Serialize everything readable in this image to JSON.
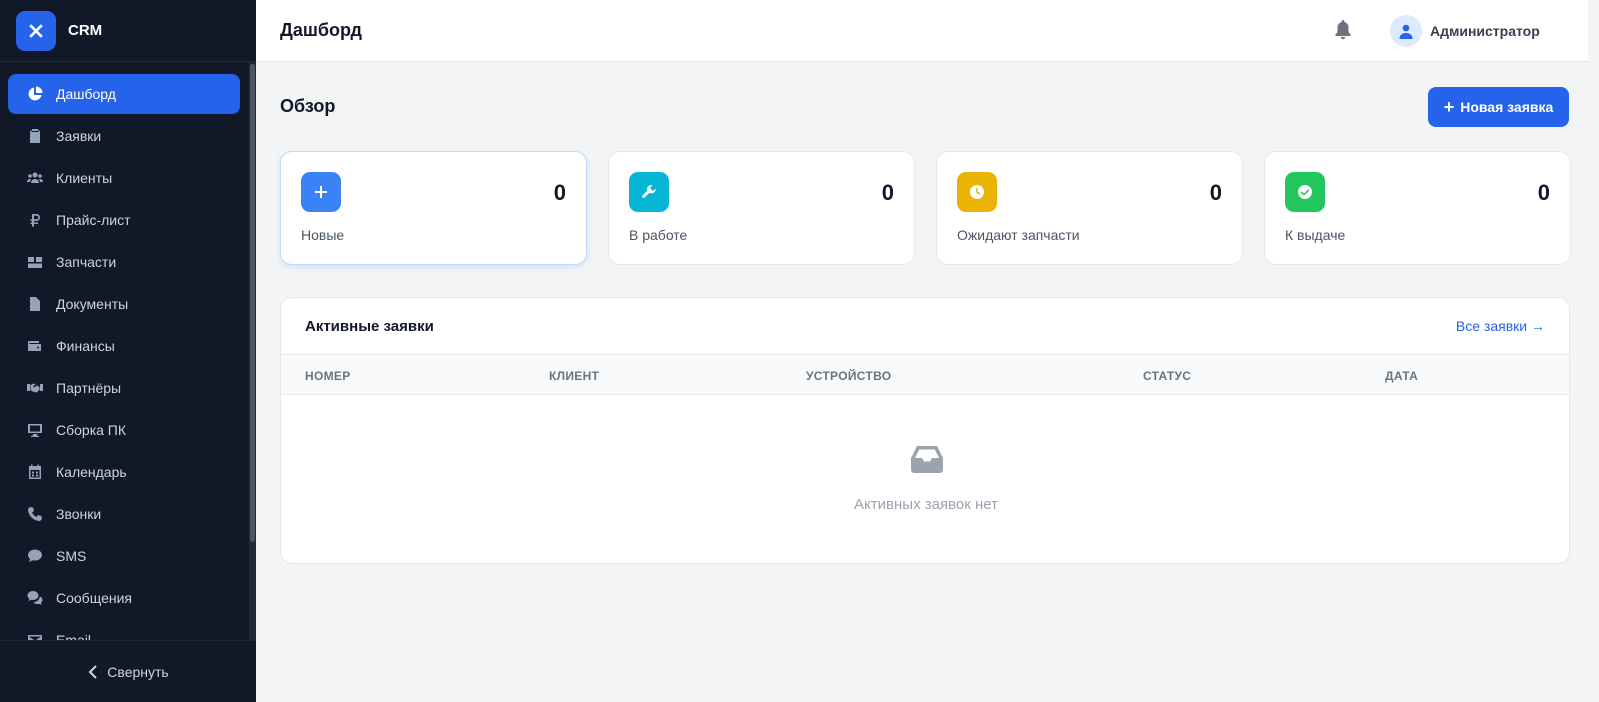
{
  "brand": {
    "name": "CRM"
  },
  "sidebar": {
    "items": [
      {
        "label": "Дашборд",
        "icon": "chart-pie-icon",
        "active": true
      },
      {
        "label": "Заявки",
        "icon": "clipboard-icon"
      },
      {
        "label": "Клиенты",
        "icon": "users-icon"
      },
      {
        "label": "Прайс-лист",
        "icon": "ruble-icon"
      },
      {
        "label": "Запчасти",
        "icon": "boxes-icon"
      },
      {
        "label": "Документы",
        "icon": "file-icon"
      },
      {
        "label": "Финансы",
        "icon": "wallet-icon"
      },
      {
        "label": "Партнёры",
        "icon": "handshake-icon"
      },
      {
        "label": "Сборка ПК",
        "icon": "desktop-icon"
      },
      {
        "label": "Календарь",
        "icon": "calendar-icon"
      },
      {
        "label": "Звонки",
        "icon": "phone-icon"
      },
      {
        "label": "SMS",
        "icon": "sms-icon"
      },
      {
        "label": "Сообщения",
        "icon": "comments-icon"
      },
      {
        "label": "Email",
        "icon": "envelope-icon"
      }
    ],
    "collapse_label": "Свернуть"
  },
  "header": {
    "title": "Дашборд",
    "user_name": "Администратор"
  },
  "main": {
    "overview_title": "Обзор",
    "new_button_label": "Новая заявка",
    "stats": [
      {
        "label": "Новые",
        "value": "0",
        "color": "#3b82f6",
        "icon": "plus-icon"
      },
      {
        "label": "В работе",
        "value": "0",
        "color": "#06b6d4",
        "icon": "wrench-icon"
      },
      {
        "label": "Ожидают запчасти",
        "value": "0",
        "color": "#eab308",
        "icon": "clock-icon"
      },
      {
        "label": "К выдаче",
        "value": "0",
        "color": "#22c55e",
        "icon": "check-circle-icon"
      }
    ],
    "active_orders": {
      "title": "Активные заявки",
      "all_link": "Все заявки →",
      "columns": [
        "НОМЕР",
        "КЛИЕНТ",
        "УСТРОЙСТВО",
        "СТАТУС",
        "ДАТА"
      ],
      "empty_text": "Активных заявок нет"
    }
  },
  "colors": {
    "accent": "#2563eb",
    "sidebar_bg": "#111827"
  }
}
